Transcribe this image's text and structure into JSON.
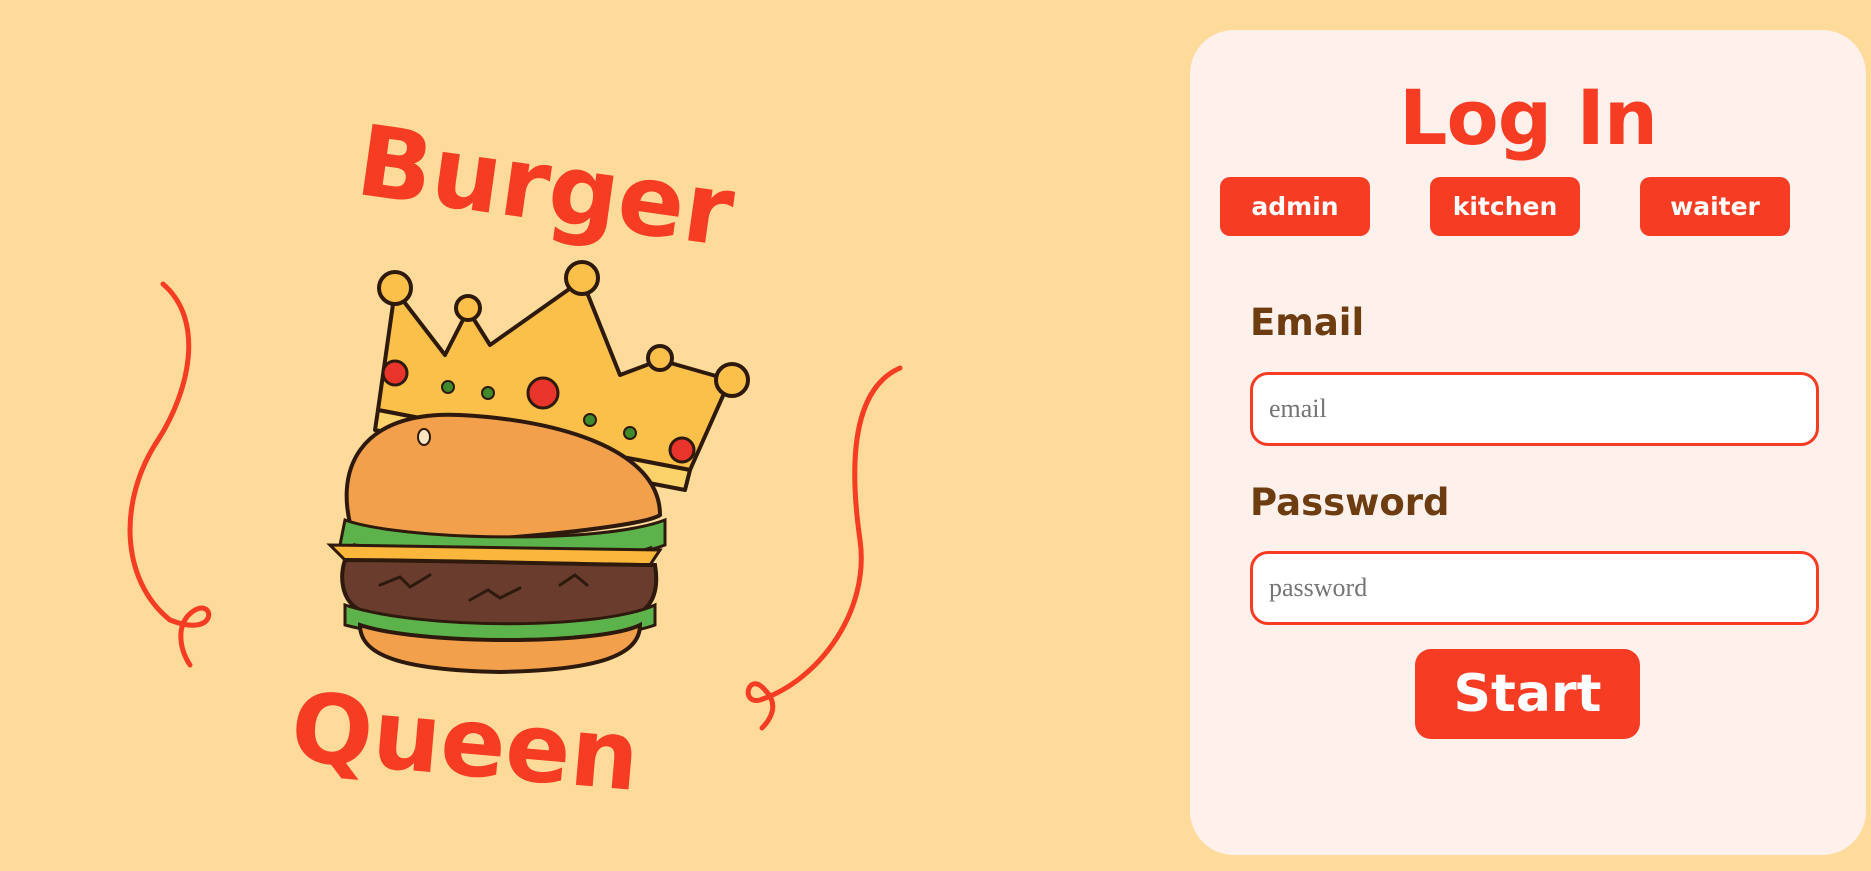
{
  "brand": {
    "line1": "Burger",
    "line2": "Queen"
  },
  "login": {
    "title": "Log In",
    "roles": [
      {
        "label": "admin"
      },
      {
        "label": "kitchen"
      },
      {
        "label": "waiter"
      }
    ],
    "email_label": "Email",
    "email_placeholder": "email",
    "email_value": "",
    "password_label": "Password",
    "password_placeholder": "password",
    "password_value": "",
    "submit_label": "Start"
  },
  "icons": {
    "logo": "crowned-burger-icon"
  },
  "colors": {
    "page_background": "#fedb9a",
    "card_background": "#fef1ec",
    "accent": "#f63c23",
    "label": "#6d3c10"
  }
}
